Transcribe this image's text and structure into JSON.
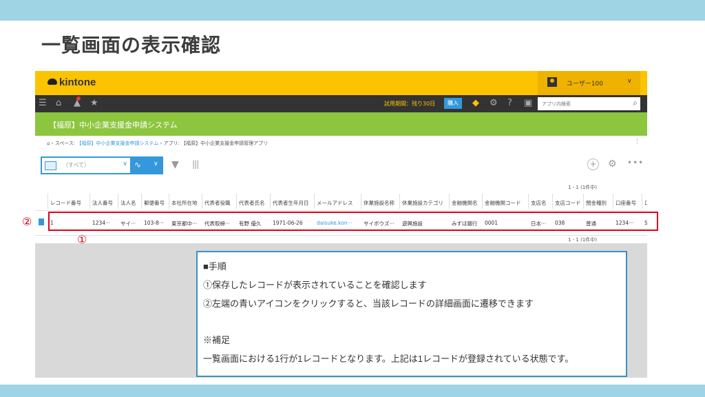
{
  "slide": {
    "title": "一覧画面の表示確認"
  },
  "kintone": {
    "logo": "kintone",
    "user_name": "ユーザー100",
    "trial_text": "試用期間：残り30日",
    "buy_label": "購入",
    "app_search_placeholder": "アプリ内検索",
    "app_title": "【福原】中小企業支援金申請システム",
    "breadcrumb": {
      "home": "⌂",
      "space_prefix": "スペース:",
      "space_link": "【福原】中小企業支援金申請システム",
      "app_prefix": "アプリ:",
      "app_link": "【福原】中小企業支援金申請管理アプリ"
    },
    "view": {
      "selected": "（すべて）"
    },
    "pager": {
      "top": "1 - 1  (1件中)",
      "bottom": "1 - 1  (1件中)"
    },
    "columns": [
      "レコード番号",
      "法人番号",
      "法人名",
      "郵便番号",
      "本社所在地",
      "代表者役職",
      "代表者氏名",
      "代表者生年月日",
      "メールアドレス",
      "休業施設名称",
      "休業施設カテゴリ",
      "金融機関名",
      "金融機関コード",
      "支店名",
      "支店コード",
      "預金種別",
      "口座番号",
      "口"
    ],
    "row": [
      "1",
      "1234···",
      "サイ···",
      "103-8···",
      "東京都中···",
      "代表取締···",
      "有野 優久",
      "1971-06-26",
      "daisuke.kon···",
      "サイボウズ···",
      "遊興施設",
      "みずほ銀行",
      "0001",
      "日本···",
      "038",
      "普通",
      "1234···",
      "S"
    ]
  },
  "markers": {
    "one": "①",
    "two": "②"
  },
  "note": {
    "heading": "■手順",
    "step1": "①保存したレコードが表示されていることを確認します",
    "step2": "②左端の青いアイコンをクリックすると、当該レコードの詳細画面に遷移できます",
    "supplement_heading": "※補足",
    "supplement": "一覧画面における1行が1レコードとなります。上記は1レコードが登録されている状態です。"
  }
}
